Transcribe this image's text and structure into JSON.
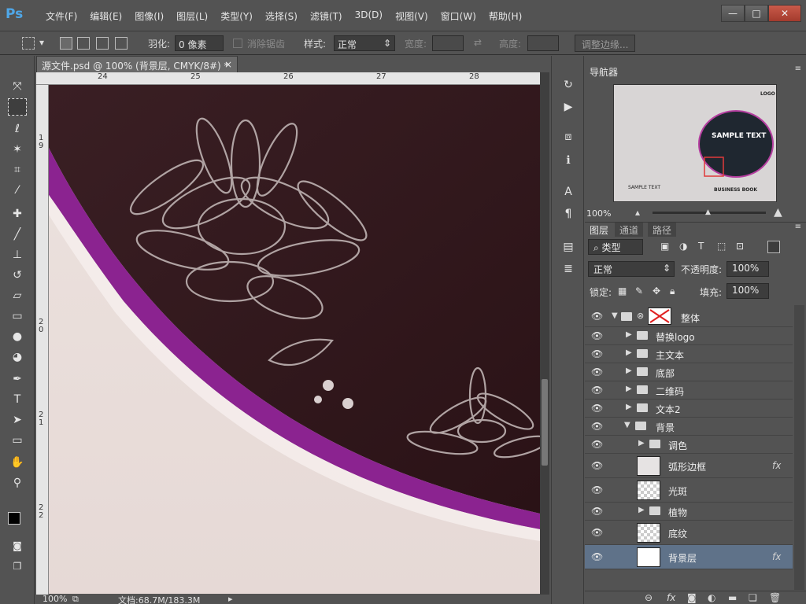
{
  "app": {
    "logo": "Ps"
  },
  "menu": [
    "文件(F)",
    "编辑(E)",
    "图像(I)",
    "图层(L)",
    "类型(Y)",
    "选择(S)",
    "滤镜(T)",
    "3D(D)",
    "视图(V)",
    "窗口(W)",
    "帮助(H)"
  ],
  "window_controls": {
    "minimize": "—",
    "restore": "□",
    "close": "✕"
  },
  "options": {
    "feather_label": "羽化:",
    "feather_value": "0 像素",
    "antialias_label": "消除锯齿",
    "style_label": "样式:",
    "style_value": "正常",
    "width_label": "宽度:",
    "height_label": "高度:",
    "refine_button": "调整边缘..."
  },
  "document": {
    "tab_title": "源文件.psd @ 100% (背景层, CMYK/8#) *",
    "ruler_top": [
      "24",
      "25",
      "26",
      "27",
      "28"
    ],
    "ruler_left": [
      "1",
      "9",
      "2",
      "0",
      "2",
      "1",
      "2",
      "2"
    ],
    "zoom": "100%",
    "doc_size": "文档:68.7M/183.3M"
  },
  "navigator": {
    "tab": "导航器",
    "zoom": "100%",
    "thumb_logo": "LOGO",
    "thumb_sample": "SAMPLE TEXT",
    "thumb_sample_sub": "SAMPLE TEXT",
    "thumb_business": "BUSINESS BOOK"
  },
  "layers_panel": {
    "tabs": [
      "图层",
      "通道",
      "路径"
    ],
    "filter_kind": "类型",
    "blend_mode": "正常",
    "opacity_label": "不透明度:",
    "opacity_value": "100%",
    "lock_label": "锁定:",
    "fill_label": "填充:",
    "fill_value": "100%",
    "layers": [
      {
        "name": "整体",
        "type": "group-open",
        "indent": 0
      },
      {
        "name": "替换logo",
        "type": "group",
        "indent": 1
      },
      {
        "name": "主文本",
        "type": "group",
        "indent": 1
      },
      {
        "name": "底部",
        "type": "group",
        "indent": 1
      },
      {
        "name": "二维码",
        "type": "group",
        "indent": 1
      },
      {
        "name": "文本2",
        "type": "group",
        "indent": 1
      },
      {
        "name": "背景",
        "type": "group-open",
        "indent": 1
      },
      {
        "name": "调色",
        "type": "group",
        "indent": 2
      },
      {
        "name": "弧形边框",
        "type": "layer-fx",
        "indent": 2
      },
      {
        "name": "光斑",
        "type": "layer",
        "indent": 2
      },
      {
        "name": "植物",
        "type": "group",
        "indent": 2
      },
      {
        "name": "底纹",
        "type": "layer",
        "indent": 2
      },
      {
        "name": "背景层",
        "type": "layer-fx-selected",
        "indent": 2
      }
    ],
    "fx": "fx"
  }
}
